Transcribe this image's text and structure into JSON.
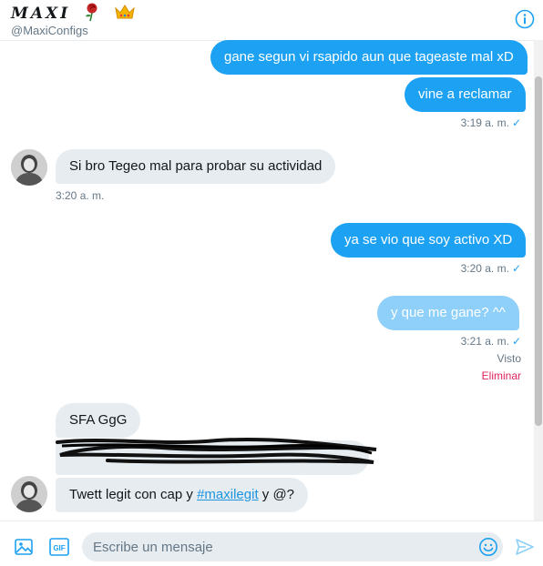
{
  "header": {
    "name": "MAXI",
    "handle": "@MaxiConfigs"
  },
  "messages": [
    {
      "text": "gane segun vi rsapido aun que tageaste mal xD"
    },
    {
      "text": "vine a reclamar"
    },
    {
      "meta": "3:19 a. m."
    },
    {
      "text": "Si bro Tegeo mal para probar su actividad"
    },
    {
      "meta": "3:20 a. m."
    },
    {
      "text": "ya se vio que soy activo XD"
    },
    {
      "meta": "3:20 a. m."
    },
    {
      "text": "y que me gane? ^^"
    },
    {
      "meta": "3:21 a. m."
    },
    {
      "status": "Visto",
      "delete": "Eliminar"
    },
    {
      "text": "SFA GgG"
    },
    {
      "text_before": "Twett legit con cap y ",
      "hashtag": "#maxilegit",
      "text_after": " y @?"
    }
  ],
  "composer": {
    "placeholder": "Escribe un mensaje"
  },
  "icons": {
    "info": "info-icon",
    "media": "image-icon",
    "gif": "gif-icon",
    "emoji": "emoji-icon",
    "send": "send-icon",
    "read": "checkmark-icon"
  },
  "colors": {
    "accent": "#1da1f2",
    "delete": "#e0245e",
    "incoming": "#e6ecf0"
  }
}
